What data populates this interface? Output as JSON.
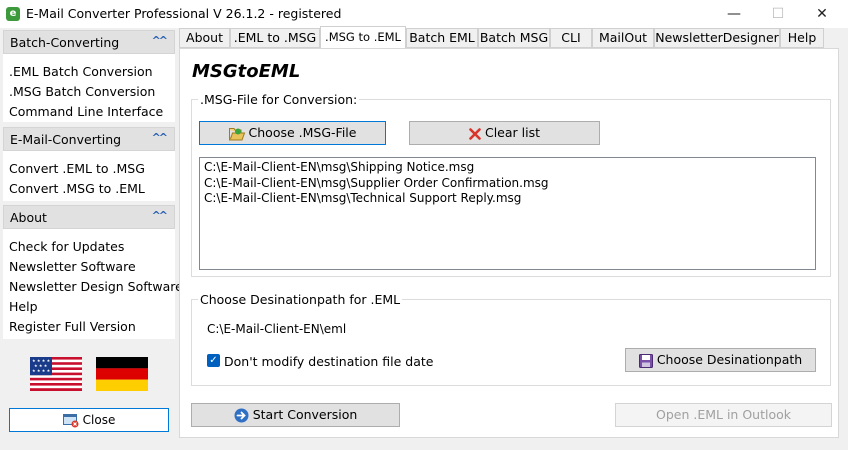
{
  "window": {
    "title": "E-Mail Converter Professional V 26.1.2 - registered",
    "app_icon_glyph": "e",
    "minimize": "—",
    "maximize": "☐",
    "close": "✕"
  },
  "sidebar": {
    "groups": [
      {
        "title": "Batch-Converting",
        "items": [
          ".EML Batch Conversion",
          ".MSG Batch Conversion",
          "Command Line Interface"
        ]
      },
      {
        "title": "E-Mail-Converting",
        "items": [
          "Convert .EML to .MSG",
          "Convert .MSG to .EML"
        ]
      },
      {
        "title": "About",
        "items": [
          "Check for Updates",
          "Newsletter Software",
          "Newsletter Design Software",
          "Help",
          "Register Full Version"
        ]
      }
    ],
    "collapse_glyph": "^^",
    "flags": [
      "us-flag",
      "germany-flag"
    ],
    "close_label": "Close"
  },
  "tabs": [
    "About",
    ".EML to .MSG",
    ".MSG to .EML",
    "Batch EML",
    "Batch MSG",
    "CLI",
    "MailOut",
    "NewsletterDesigner",
    "Help"
  ],
  "active_tab_index": 2,
  "panel": {
    "heading": "MSGtoEML",
    "msg_group": {
      "legend": ".MSG-File for Conversion:",
      "choose_label": "Choose .MSG-File",
      "clear_label": "Clear list",
      "files": [
        "C:\\E-Mail-Client-EN\\msg\\Shipping Notice.msg",
        "C:\\E-Mail-Client-EN\\msg\\Supplier Order Confirmation.msg",
        "C:\\E-Mail-Client-EN\\msg\\Technical Support Reply.msg"
      ]
    },
    "dest_group": {
      "legend": "Choose Desinationpath for .EML",
      "path": "C:\\E-Mail-Client-EN\\eml",
      "keep_date_label": "Don't modify destination file date",
      "keep_date_checked": true,
      "choose_dest_label": "Choose Desinationpath"
    },
    "start_label": "Start Conversion",
    "open_outlook_label": "Open .EML in Outlook"
  },
  "colors": {
    "accent": "#0078d7",
    "checkbox": "#0060c0",
    "app_icon": "#3c9a3c"
  }
}
